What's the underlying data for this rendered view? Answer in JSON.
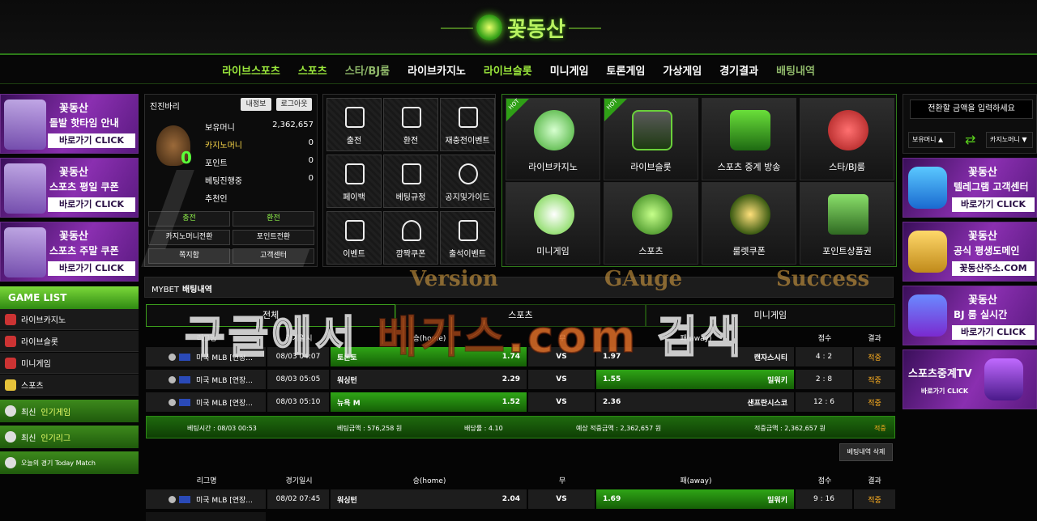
{
  "header": {
    "logo_text": "꽃동산"
  },
  "nav": [
    "라이브스포츠",
    "스포츠",
    "스타/BJ룸",
    "라이브카지노",
    "라이브슬롯",
    "미니게임",
    "토론게임",
    "가상게임",
    "경기결과",
    "배팅내역"
  ],
  "left_banners": [
    {
      "brand": "꽃동산",
      "title": "돌발 핫타임 안내",
      "cta": "바로가기 CLICK"
    },
    {
      "brand": "꽃동산",
      "title": "스포츠 평일 쿠폰",
      "cta": "바로가기 CLICK"
    },
    {
      "brand": "꽃동산",
      "title": "스포츠 주말 쿠폰",
      "cta": "바로가기 CLICK"
    }
  ],
  "game_list": {
    "title": "GAME LIST",
    "items": [
      "라이브카지노",
      "라이브슬롯",
      "미니게임",
      "스포츠"
    ],
    "popular": [
      {
        "pre": "최신",
        "hl": "인기게임"
      },
      {
        "pre": "최신",
        "hl": "인기리그"
      }
    ],
    "today": "오늘의 경기 Today Match"
  },
  "account": {
    "username": "진진바리",
    "btn_info": "내정보",
    "btn_logout": "로그아웃",
    "level": "0",
    "rows": [
      {
        "k": "보유머니",
        "v": "2,362,657"
      },
      {
        "k": "카지노머니",
        "v": "0"
      },
      {
        "k": "포인트",
        "v": "0"
      },
      {
        "k": "베팅진행중",
        "v": "0"
      },
      {
        "k": "추천인",
        "v": ""
      }
    ],
    "buttons": [
      "충전",
      "환전",
      "카지노머니전환",
      "포인트전환",
      "쪽지함",
      "고객센터"
    ]
  },
  "icon_grid": [
    "출전",
    "환전",
    "재충전이벤트",
    "페이백",
    "베팅규정",
    "공지및가이드",
    "이벤트",
    "깜짝쿠폰",
    "출석이벤트"
  ],
  "feature_grid": [
    {
      "label": "라이브카지노",
      "hot": "HOT"
    },
    {
      "label": "라이브슬롯",
      "hot": "HOT"
    },
    {
      "label": "스포츠 중계 방송",
      "hot": ""
    },
    {
      "label": "스타/BJ룸",
      "hot": ""
    },
    {
      "label": "미니게임",
      "hot": ""
    },
    {
      "label": "스포츠",
      "hot": ""
    },
    {
      "label": "룰렛쿠폰",
      "hot": ""
    },
    {
      "label": "포인트상품권",
      "hot": ""
    }
  ],
  "transfer": {
    "placeholder": "전환할 금액을 입력하세요",
    "from": "보유머니 ▲",
    "to": "카지노머니 ▼",
    "swap": "⇄"
  },
  "right_banners": [
    {
      "brand": "꽃동산",
      "title": "텔레그램 고객센터",
      "cta": "바로가기 CLICK"
    },
    {
      "brand": "꽃동산",
      "title": "공식 평생도메인",
      "cta": "꽃동산주소.COM"
    },
    {
      "brand": "꽃동산",
      "title": "BJ 룸 실시간",
      "cta": "바로가기 CLICK"
    },
    {
      "brand": "",
      "title": "스포츠중계TV",
      "cta": "바로가기 CLICK"
    }
  ],
  "mybet": {
    "prefix": "MYBET",
    "title": "배팅내역"
  },
  "tabs": [
    "전체",
    "스포츠",
    "미니게임"
  ],
  "columns": [
    "리그명",
    "경기일시",
    "승(home)",
    "무",
    "패(away)",
    "점수",
    "결과"
  ],
  "bets1": [
    {
      "league": "미국 MLB [연장...",
      "date": "08/03 04:07",
      "home": "토론토",
      "home_odds": "1.74",
      "vs": "VS",
      "away_odds": "1.97",
      "away": "캔자스시티",
      "score": "4 : 2",
      "result": "적중",
      "pick": "home"
    },
    {
      "league": "미국 MLB [연장...",
      "date": "08/03 05:05",
      "home": "워싱턴",
      "home_odds": "2.29",
      "vs": "VS",
      "away_odds": "1.55",
      "away": "밀워키",
      "score": "2 : 8",
      "result": "적중",
      "pick": "away"
    },
    {
      "league": "미국 MLB [연장...",
      "date": "08/03 05:10",
      "home": "뉴욕 M",
      "home_odds": "1.52",
      "vs": "VS",
      "away_odds": "2.36",
      "away": "샌프란시스코",
      "score": "12 : 6",
      "result": "적중",
      "pick": "home"
    }
  ],
  "summary": {
    "time": "베팅시간 : 08/03 00:53",
    "amount": "베팅금액 : 576,258 원",
    "odds": "배당률 : 4.10",
    "expected": "예상 적중금액 : 2,362,657 원",
    "won": "적중금액 : 2,362,657 원",
    "result": "적중"
  },
  "delete_btn": "베팅내역 삭제",
  "bets2": [
    {
      "league": "미국 MLB [연장...",
      "date": "08/02 07:45",
      "home": "워싱턴",
      "home_odds": "2.04",
      "vs": "VS",
      "away_odds": "1.69",
      "away": "밀워키",
      "score": "9 : 16",
      "result": "적중",
      "pick": "away"
    }
  ],
  "watermark": {
    "line1": [
      "Version",
      "GAuge",
      "Success"
    ],
    "line2a": "구글에서 ",
    "line2b": "베가스.com",
    "line2c": " 검색"
  }
}
